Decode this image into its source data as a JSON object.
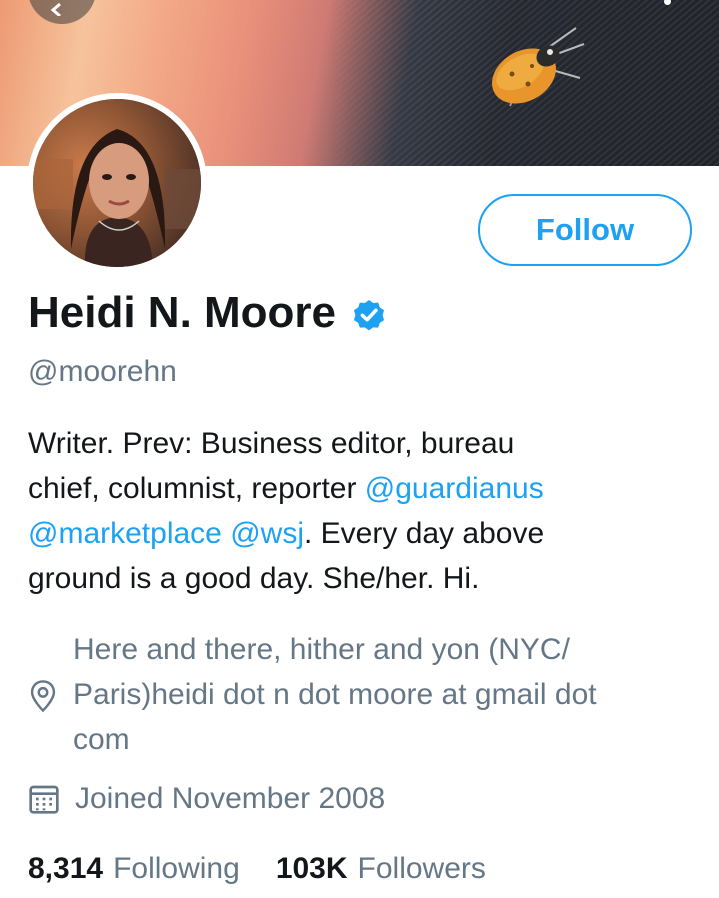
{
  "profile": {
    "name": "Heidi N. Moore",
    "handle": "@moorehn",
    "follow_label": "Follow",
    "bio": {
      "line1": "Writer. Prev: Business editor, bureau",
      "line2_text": "chief, columnist, reporter ",
      "line2_mention": "@guardianus",
      "line3_mention1": "@marketplace",
      "line3_mention2": "@wsj",
      "line3_text": ". Every day above",
      "line4": "ground is a good day. She/her. Hi."
    },
    "location_lines": [
      "Here and there, hither and yon (NYC/",
      "Paris)heidi dot n dot moore at gmail dot",
      "com"
    ],
    "joined": "Joined November 2008",
    "following_count": "8,314",
    "following_label": "Following",
    "followers_count": "103K",
    "followers_label": "Followers"
  },
  "icons": {
    "back": "back-arrow-icon",
    "more": "more-vertical-icon",
    "verified": "verified-badge-icon",
    "location": "location-pin-icon",
    "calendar": "calendar-icon"
  },
  "colors": {
    "accent": "#1da1f2",
    "text": "#14171a",
    "secondary": "#657786"
  }
}
